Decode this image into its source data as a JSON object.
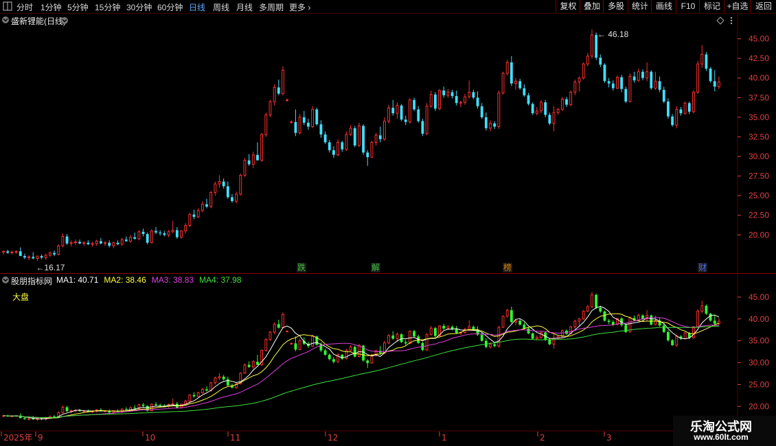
{
  "toolbar": {
    "timeframes": [
      "分时",
      "1分钟",
      "5分钟",
      "15分钟",
      "30分钟",
      "60分钟",
      "日线",
      "周线",
      "月线",
      "多周期",
      "更多"
    ],
    "active_timeframe": "日线",
    "right_buttons": [
      "复权",
      "叠加",
      "多股",
      "统计",
      "画线",
      "F10",
      "标记",
      "+自选",
      "返回"
    ]
  },
  "main_chart": {
    "title": "盛新锂能(日线)",
    "y_ticks": [
      "45.00",
      "42.50",
      "40.00",
      "37.50",
      "35.00",
      "32.50",
      "30.00",
      "27.50",
      "25.00",
      "22.50",
      "20.00"
    ],
    "high_label": "46.18",
    "low_label": "16.17",
    "badges": [
      {
        "text": "跌",
        "color": "#40c040"
      },
      {
        "text": "解",
        "color": "#40c040"
      },
      {
        "text": "榜",
        "color": "#e08000"
      },
      {
        "text": "财",
        "color": "#4a6cff"
      }
    ]
  },
  "indicator_panel": {
    "title": "股朋指标网",
    "ma": [
      {
        "name": "MA1",
        "value": "40.71",
        "color": "#ffffff"
      },
      {
        "name": "MA2",
        "value": "38.46",
        "color": "#ffff40"
      },
      {
        "name": "MA3",
        "value": "38.83",
        "color": "#e040e0"
      },
      {
        "name": "MA4",
        "value": "37.98",
        "color": "#40e040"
      }
    ],
    "market_label": "大盘",
    "y_ticks": [
      "45.00",
      "40.00",
      "35.00",
      "30.00",
      "25.00",
      "20.00"
    ]
  },
  "time_axis": {
    "labels": [
      "2025年",
      "9",
      "10",
      "11",
      "12",
      "1",
      "2",
      "3"
    ]
  },
  "watermark": {
    "line1": "乐淘公式网",
    "line2": "www.60lt.com"
  },
  "colors": {
    "up": "#ff3030",
    "down": "#40e0ff",
    "down_ind": "#30ff30",
    "grid": "#5a0000",
    "axis": "#e04040"
  },
  "chart_data": {
    "type": "candlestick",
    "ohlc": [
      [
        17.8,
        18.0,
        17.5,
        17.9
      ],
      [
        17.9,
        18.1,
        17.6,
        17.7
      ],
      [
        17.7,
        18.0,
        17.5,
        17.8
      ],
      [
        17.8,
        18.0,
        17.6,
        17.9
      ],
      [
        17.9,
        18.4,
        17.7,
        17.3
      ],
      [
        17.3,
        17.6,
        16.9,
        17.1
      ],
      [
        17.1,
        17.4,
        16.8,
        17.2
      ],
      [
        17.2,
        17.8,
        16.9,
        17.0
      ],
      [
        17.0,
        17.3,
        16.7,
        17.3
      ],
      [
        17.3,
        17.5,
        16.9,
        17.1
      ],
      [
        17.1,
        17.6,
        16.8,
        17.4
      ],
      [
        17.4,
        17.9,
        17.2,
        17.7
      ],
      [
        17.7,
        18.0,
        17.3,
        17.5
      ],
      [
        17.5,
        18.8,
        17.4,
        18.6
      ],
      [
        18.6,
        20.2,
        18.4,
        19.8
      ],
      [
        19.8,
        20.1,
        18.7,
        18.9
      ],
      [
        18.9,
        19.3,
        18.5,
        19.0
      ],
      [
        19.0,
        19.4,
        18.7,
        19.1
      ],
      [
        19.1,
        19.4,
        18.8,
        18.9
      ],
      [
        18.9,
        19.2,
        18.6,
        19.0
      ],
      [
        19.0,
        19.3,
        18.7,
        18.8
      ],
      [
        18.8,
        19.1,
        18.5,
        18.9
      ],
      [
        18.9,
        19.4,
        18.6,
        19.2
      ],
      [
        19.2,
        19.6,
        18.8,
        18.9
      ],
      [
        18.9,
        19.2,
        18.6,
        19.0
      ],
      [
        19.0,
        19.3,
        18.4,
        18.6
      ],
      [
        18.6,
        19.1,
        18.3,
        19.0
      ],
      [
        19.0,
        19.3,
        18.7,
        18.8
      ],
      [
        18.8,
        19.6,
        18.6,
        19.4
      ],
      [
        19.4,
        19.8,
        19.1,
        19.2
      ],
      [
        19.2,
        20.0,
        19.0,
        19.7
      ],
      [
        19.7,
        20.3,
        19.4,
        19.5
      ],
      [
        19.5,
        20.6,
        19.3,
        20.4
      ],
      [
        20.4,
        20.8,
        19.8,
        20.1
      ],
      [
        20.1,
        20.3,
        18.8,
        19.0
      ],
      [
        19.0,
        20.7,
        18.9,
        20.5
      ],
      [
        20.5,
        21.0,
        20.1,
        20.3
      ],
      [
        20.3,
        20.6,
        19.9,
        20.2
      ],
      [
        20.2,
        20.5,
        19.8,
        20.0
      ],
      [
        20.0,
        20.6,
        19.7,
        20.4
      ],
      [
        20.4,
        21.8,
        20.2,
        20.6
      ],
      [
        20.6,
        21.0,
        19.5,
        19.7
      ],
      [
        19.7,
        20.6,
        19.5,
        20.5
      ],
      [
        20.5,
        21.5,
        20.2,
        21.2
      ],
      [
        21.2,
        22.8,
        21.0,
        22.6
      ],
      [
        22.6,
        23.2,
        22.0,
        22.3
      ],
      [
        22.3,
        23.4,
        22.1,
        23.1
      ],
      [
        23.1,
        24.3,
        22.9,
        23.9
      ],
      [
        23.9,
        24.6,
        23.4,
        23.6
      ],
      [
        23.6,
        25.6,
        23.4,
        25.4
      ],
      [
        25.4,
        26.8,
        25.0,
        26.5
      ],
      [
        26.5,
        27.6,
        26.0,
        26.8
      ],
      [
        26.8,
        27.2,
        25.9,
        26.2
      ],
      [
        26.2,
        26.8,
        24.6,
        24.8
      ],
      [
        24.8,
        25.2,
        24.1,
        24.3
      ],
      [
        24.3,
        25.5,
        24.0,
        25.2
      ],
      [
        25.2,
        27.8,
        25.0,
        27.6
      ],
      [
        27.6,
        29.8,
        27.4,
        29.5
      ],
      [
        29.5,
        30.3,
        28.8,
        29.0
      ],
      [
        29.0,
        30.6,
        28.5,
        30.2
      ],
      [
        30.2,
        31.8,
        29.8,
        29.5
      ],
      [
        29.5,
        33.0,
        29.3,
        32.8
      ],
      [
        32.8,
        35.6,
        32.5,
        35.3
      ],
      [
        35.3,
        37.2,
        35.0,
        37.0
      ],
      [
        37.0,
        39.2,
        36.5,
        38.8
      ],
      [
        38.8,
        39.8,
        37.8,
        38.0
      ],
      [
        38.0,
        41.5,
        37.8,
        41.0
      ],
      [
        37.2,
        37.4,
        37.0,
        37.2
      ],
      [
        34.4,
        34.6,
        34.2,
        34.4
      ],
      [
        34.4,
        36.0,
        32.6,
        33.0
      ],
      [
        33.0,
        35.4,
        32.8,
        35.0
      ],
      [
        35.0,
        35.8,
        34.0,
        34.3
      ],
      [
        34.3,
        34.8,
        33.4,
        33.8
      ],
      [
        33.8,
        36.4,
        33.6,
        36.0
      ],
      [
        36.0,
        36.2,
        33.9,
        34.1
      ],
      [
        34.1,
        34.6,
        32.4,
        32.8
      ],
      [
        32.8,
        33.2,
        31.6,
        31.8
      ],
      [
        31.8,
        32.1,
        30.5,
        30.8
      ],
      [
        30.8,
        31.3,
        29.8,
        30.2
      ],
      [
        30.2,
        32.2,
        30.0,
        31.8
      ],
      [
        31.8,
        32.0,
        30.6,
        30.9
      ],
      [
        30.9,
        33.2,
        30.7,
        32.8
      ],
      [
        32.8,
        34.0,
        32.6,
        33.6
      ],
      [
        33.6,
        33.9,
        31.2,
        31.4
      ],
      [
        31.4,
        34.3,
        31.2,
        33.9
      ],
      [
        33.9,
        34.1,
        30.2,
        30.5
      ],
      [
        30.5,
        30.8,
        28.8,
        29.9
      ],
      [
        29.9,
        32.0,
        29.8,
        31.8
      ],
      [
        31.8,
        33.0,
        31.4,
        32.7
      ],
      [
        32.7,
        33.8,
        31.8,
        32.2
      ],
      [
        32.2,
        35.0,
        32.0,
        34.5
      ],
      [
        34.5,
        36.6,
        34.2,
        36.2
      ],
      [
        36.2,
        37.2,
        35.2,
        35.5
      ],
      [
        35.5,
        36.9,
        34.8,
        36.5
      ],
      [
        36.5,
        36.7,
        34.5,
        34.7
      ],
      [
        34.7,
        35.2,
        34.0,
        34.4
      ],
      [
        34.4,
        37.4,
        34.2,
        37.2
      ],
      [
        37.2,
        37.5,
        35.8,
        36.0
      ],
      [
        36.0,
        36.4,
        34.3,
        34.5
      ],
      [
        34.5,
        34.8,
        32.6,
        32.9
      ],
      [
        32.9,
        36.8,
        32.7,
        36.4
      ],
      [
        36.4,
        38.4,
        36.2,
        37.9
      ],
      [
        37.9,
        38.2,
        35.8,
        36.1
      ],
      [
        36.1,
        38.6,
        35.9,
        38.4
      ],
      [
        38.4,
        38.9,
        37.5,
        37.8
      ],
      [
        37.8,
        38.6,
        37.5,
        38.2
      ],
      [
        38.2,
        38.5,
        37.4,
        37.7
      ],
      [
        37.7,
        38.4,
        36.5,
        36.8
      ],
      [
        36.8,
        37.1,
        36.3,
        36.9
      ],
      [
        36.9,
        38.0,
        36.6,
        37.6
      ],
      [
        37.6,
        39.7,
        37.4,
        38.2
      ],
      [
        38.2,
        38.5,
        37.3,
        37.5
      ],
      [
        37.5,
        38.3,
        36.1,
        36.4
      ],
      [
        36.4,
        36.8,
        34.8,
        35.0
      ],
      [
        35.0,
        35.6,
        33.3,
        33.6
      ],
      [
        33.6,
        34.6,
        33.2,
        34.2
      ],
      [
        34.2,
        34.5,
        33.5,
        33.8
      ],
      [
        33.8,
        38.4,
        33.5,
        38.1
      ],
      [
        38.1,
        40.8,
        37.9,
        40.6
      ],
      [
        40.6,
        42.3,
        40.3,
        42.0
      ],
      [
        42.0,
        42.8,
        39.0,
        39.3
      ],
      [
        39.3,
        40.0,
        38.5,
        39.6
      ],
      [
        39.6,
        39.9,
        38.5,
        38.7
      ],
      [
        38.7,
        39.2,
        37.6,
        37.8
      ],
      [
        37.8,
        38.1,
        36.5,
        36.7
      ],
      [
        36.7,
        36.9,
        35.3,
        35.5
      ],
      [
        35.5,
        36.3,
        35.2,
        35.8
      ],
      [
        35.8,
        37.2,
        35.5,
        36.9
      ],
      [
        36.9,
        37.2,
        35.0,
        35.3
      ],
      [
        35.3,
        35.6,
        34.0,
        34.2
      ],
      [
        34.2,
        36.4,
        33.2,
        35.6
      ],
      [
        35.6,
        36.2,
        35.3,
        36.0
      ],
      [
        36.0,
        37.6,
        35.8,
        37.3
      ],
      [
        37.3,
        37.6,
        36.3,
        36.6
      ],
      [
        36.6,
        38.4,
        36.4,
        38.2
      ],
      [
        38.2,
        39.8,
        37.8,
        39.5
      ],
      [
        39.5,
        40.2,
        38.3,
        40.0
      ],
      [
        40.0,
        42.0,
        39.8,
        41.8
      ],
      [
        41.8,
        43.2,
        41.5,
        42.8
      ],
      [
        42.8,
        46.18,
        42.5,
        45.5
      ],
      [
        45.5,
        45.8,
        42.3,
        42.6
      ],
      [
        42.6,
        43.0,
        41.4,
        41.7
      ],
      [
        41.7,
        41.9,
        39.4,
        39.6
      ],
      [
        39.6,
        40.0,
        38.8,
        39.3
      ],
      [
        39.3,
        39.7,
        38.4,
        38.7
      ],
      [
        38.7,
        40.3,
        38.6,
        40.1
      ],
      [
        40.1,
        40.4,
        38.2,
        38.6
      ],
      [
        38.6,
        38.9,
        36.8,
        37.0
      ],
      [
        37.0,
        40.6,
        36.9,
        40.2
      ],
      [
        40.2,
        40.8,
        39.4,
        39.7
      ],
      [
        39.7,
        41.2,
        39.5,
        40.8
      ],
      [
        40.8,
        41.1,
        39.7,
        40.0
      ],
      [
        40.0,
        42.0,
        39.6,
        40.8
      ],
      [
        40.8,
        41.0,
        38.5,
        38.7
      ],
      [
        38.7,
        40.8,
        38.5,
        39.6
      ],
      [
        39.6,
        40.2,
        38.2,
        38.5
      ],
      [
        38.5,
        38.9,
        36.8,
        37.0
      ],
      [
        37.0,
        37.4,
        34.8,
        35.1
      ],
      [
        35.1,
        35.4,
        33.8,
        34.0
      ],
      [
        34.0,
        36.4,
        33.6,
        36.0
      ],
      [
        36.0,
        36.3,
        35.2,
        35.5
      ],
      [
        35.5,
        37.0,
        35.3,
        36.8
      ],
      [
        36.8,
        37.0,
        35.4,
        35.7
      ],
      [
        35.7,
        38.4,
        35.5,
        38.2
      ],
      [
        38.2,
        42.2,
        38.0,
        41.8
      ],
      [
        41.8,
        44.2,
        41.3,
        43.0
      ],
      [
        43.0,
        43.3,
        40.9,
        41.2
      ],
      [
        41.2,
        41.4,
        39.4,
        39.6
      ],
      [
        39.6,
        41.0,
        38.3,
        38.9
      ],
      [
        38.9,
        40.2,
        38.6,
        39.5
      ]
    ],
    "y_range": [
      16.0,
      47.5
    ],
    "indicator_y_range": [
      18.0,
      47.5
    ]
  }
}
